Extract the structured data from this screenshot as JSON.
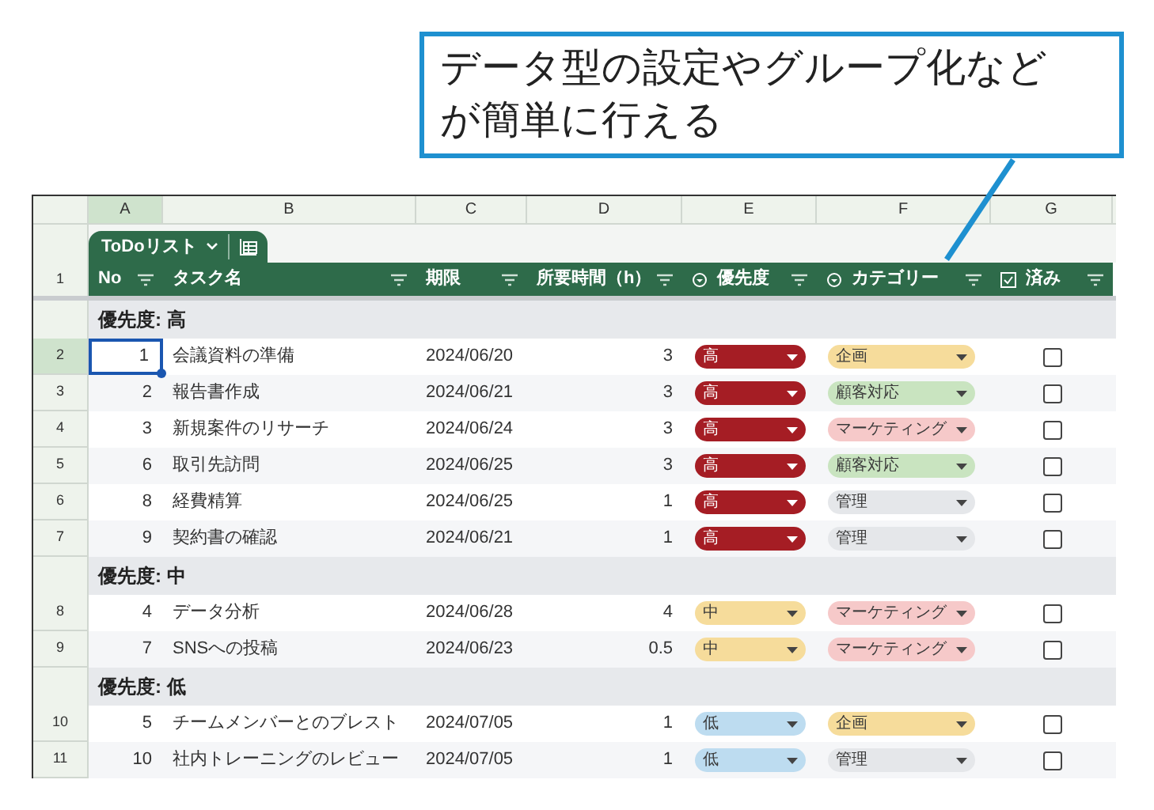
{
  "callout": {
    "lines": [
      "データ型の設定やグループ化など",
      "が簡単に行える"
    ]
  },
  "sheet": {
    "column_letters": [
      {
        "label": "A",
        "selected": true
      },
      {
        "label": "B",
        "selected": false
      },
      {
        "label": "C",
        "selected": false
      },
      {
        "label": "D",
        "selected": false
      },
      {
        "label": "E",
        "selected": false
      },
      {
        "label": "F",
        "selected": false
      },
      {
        "label": "G",
        "selected": false
      }
    ],
    "table_tab": {
      "label": "ToDoリスト"
    },
    "header_row_number": "1",
    "columns": [
      {
        "label": "No",
        "kind": "plain"
      },
      {
        "label": "タスク名",
        "kind": "plain"
      },
      {
        "label": "期限",
        "kind": "plain"
      },
      {
        "label": "所要時間（h）",
        "kind": "plain"
      },
      {
        "label": "優先度",
        "kind": "dropdown"
      },
      {
        "label": "カテゴリー",
        "kind": "dropdown"
      },
      {
        "label": "済み",
        "kind": "checkbox"
      }
    ],
    "groups": [
      {
        "label": "優先度: 高",
        "rows": [
          {
            "row_number": "2",
            "selected": true,
            "no": "1",
            "task": "会議資料の準備",
            "due": "2024/06/20",
            "hours": "3",
            "priority": {
              "label": "高",
              "color": "#a51d24"
            },
            "category": {
              "label": "企画",
              "color": "#f6dc9b"
            },
            "done": false
          },
          {
            "row_number": "3",
            "selected": false,
            "no": "2",
            "task": "報告書作成",
            "due": "2024/06/21",
            "hours": "3",
            "priority": {
              "label": "高",
              "color": "#a51d24"
            },
            "category": {
              "label": "顧客対応",
              "color": "#c9e4c0"
            },
            "done": false
          },
          {
            "row_number": "4",
            "selected": false,
            "no": "3",
            "task": "新規案件のリサーチ",
            "due": "2024/06/24",
            "hours": "3",
            "priority": {
              "label": "高",
              "color": "#a51d24"
            },
            "category": {
              "label": "マーケティング",
              "color": "#f6c9c9"
            },
            "done": false
          },
          {
            "row_number": "5",
            "selected": false,
            "no": "6",
            "task": "取引先訪問",
            "due": "2024/06/25",
            "hours": "3",
            "priority": {
              "label": "高",
              "color": "#a51d24"
            },
            "category": {
              "label": "顧客対応",
              "color": "#c9e4c0"
            },
            "done": false
          },
          {
            "row_number": "6",
            "selected": false,
            "no": "8",
            "task": "経費精算",
            "due": "2024/06/25",
            "hours": "1",
            "priority": {
              "label": "高",
              "color": "#a51d24"
            },
            "category": {
              "label": "管理",
              "color": "#e5e7ea"
            },
            "done": false
          },
          {
            "row_number": "7",
            "selected": false,
            "no": "9",
            "task": "契約書の確認",
            "due": "2024/06/21",
            "hours": "1",
            "priority": {
              "label": "高",
              "color": "#a51d24"
            },
            "category": {
              "label": "管理",
              "color": "#e5e7ea"
            },
            "done": false
          }
        ]
      },
      {
        "label": "優先度: 中",
        "rows": [
          {
            "row_number": "8",
            "selected": false,
            "no": "4",
            "task": "データ分析",
            "due": "2024/06/28",
            "hours": "4",
            "priority": {
              "label": "中",
              "color": "#f6dc9b"
            },
            "category": {
              "label": "マーケティング",
              "color": "#f6c9c9"
            },
            "done": false
          },
          {
            "row_number": "9",
            "selected": false,
            "no": "7",
            "task": "SNSへの投稿",
            "due": "2024/06/23",
            "hours": "0.5",
            "priority": {
              "label": "中",
              "color": "#f6dc9b"
            },
            "category": {
              "label": "マーケティング",
              "color": "#f6c9c9"
            },
            "done": false
          }
        ]
      },
      {
        "label": "優先度: 低",
        "rows": [
          {
            "row_number": "10",
            "selected": false,
            "no": "5",
            "task": "チームメンバーとのブレスト",
            "due": "2024/07/05",
            "hours": "1",
            "priority": {
              "label": "低",
              "color": "#bddcf0"
            },
            "category": {
              "label": "企画",
              "color": "#f6dc9b"
            },
            "done": false
          },
          {
            "row_number": "11",
            "selected": false,
            "no": "10",
            "task": "社内トレーニングのレビュー",
            "due": "2024/07/05",
            "hours": "1",
            "priority": {
              "label": "低",
              "color": "#bddcf0"
            },
            "category": {
              "label": "管理",
              "color": "#e5e7ea"
            },
            "done": false
          }
        ]
      }
    ]
  }
}
